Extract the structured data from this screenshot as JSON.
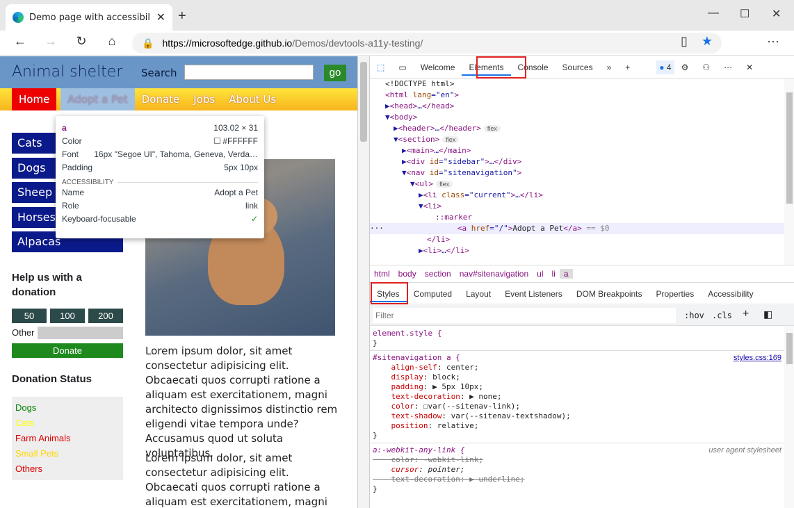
{
  "browser": {
    "tab_title": "Demo page with accessibility issu",
    "url_domain": "https://microsoftedge.github.io",
    "url_path": "/Demos/devtools-a11y-testing/"
  },
  "page": {
    "logo": "Animal shelter",
    "search_label": "Search",
    "go": "go",
    "nav": [
      "Home",
      "Adopt a Pet",
      "Donate",
      "Jobs",
      "About Us"
    ],
    "sidebar": [
      "Cats",
      "Dogs",
      "Sheep",
      "Horses",
      "Alpacas"
    ],
    "help_title": "Help us with a donation",
    "amounts": [
      "50",
      "100",
      "200"
    ],
    "other_label": "Other",
    "donate_btn": "Donate",
    "status_title": "Donation Status",
    "status_items": [
      {
        "label": "Dogs",
        "color": "#008000"
      },
      {
        "label": "Cats",
        "color": "#ffff00"
      },
      {
        "label": "Farm Animals",
        "color": "#e00000"
      },
      {
        "label": "Small Pets",
        "color": "#ffd800"
      },
      {
        "label": "Others",
        "color": "#e00000"
      }
    ],
    "lorem1": "Lorem ipsum dolor, sit amet consectetur adipisicing elit. Obcaecati quos corrupti ratione a aliquam est exercitationem, magni architecto dignissimos distinctio rem eligendi vitae tempora unde? Accusamus quod ut soluta voluptatibus.",
    "lorem2": "Lorem ipsum dolor, sit amet consectetur adipisicing elit. Obcaecati quos corrupti ratione a aliquam est exercitationem, magni architecto"
  },
  "tooltip": {
    "tag": "a",
    "size": "103.02 × 31",
    "color_label": "Color",
    "color_value": "#FFFFFF",
    "font_label": "Font",
    "font_value": "16px \"Segoe UI\", Tahoma, Geneva, Verda…",
    "padding_label": "Padding",
    "padding_value": "5px 10px",
    "section": "ACCESSIBILITY",
    "name_label": "Name",
    "name_value": "Adopt a Pet",
    "role_label": "Role",
    "role_value": "link",
    "kbd_label": "Keyboard-focusable"
  },
  "devtools": {
    "tabs": [
      "Welcome",
      "Elements",
      "Console",
      "Sources"
    ],
    "issues_count": "4",
    "breadcrumb": [
      "html",
      "body",
      "section",
      "nav#sitenavigation",
      "ul",
      "li",
      "a"
    ],
    "subtabs": [
      "Styles",
      "Computed",
      "Layout",
      "Event Listeners",
      "DOM Breakpoints",
      "Properties",
      "Accessibility"
    ],
    "filter_placeholder": "Filter",
    "hov": ":hov",
    "cls": ".cls",
    "rule1_selector": "element.style {",
    "rule2_selector": "#sitenavigation a {",
    "rule2_source": "styles.css:169",
    "rule3_selector": "a:-webkit-any-link {",
    "rule3_source": "user agent stylesheet"
  }
}
